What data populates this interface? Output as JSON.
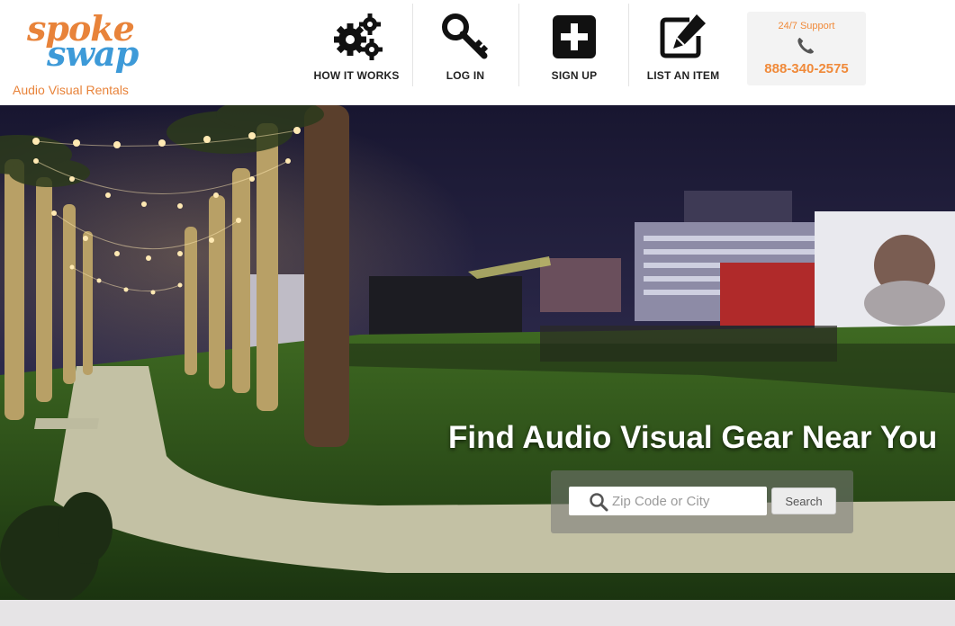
{
  "brand": {
    "logo_line1": "spoke",
    "logo_line2": "swap",
    "tagline": "Audio Visual Rentals",
    "colors": {
      "orange": "#e8833a",
      "blue": "#3d9ad8"
    }
  },
  "nav": [
    {
      "label": "HOW IT WORKS",
      "icon": "gears-icon"
    },
    {
      "label": "LOG IN",
      "icon": "key-icon"
    },
    {
      "label": "SIGN UP",
      "icon": "plus-square-icon"
    },
    {
      "label": "LIST AN ITEM",
      "icon": "edit-pencil-icon"
    }
  ],
  "support": {
    "label": "24/7 Support",
    "phone": "888-340-2575",
    "icon": "phone-icon"
  },
  "hero": {
    "headline": "Find Audio Visual Gear Near You",
    "search": {
      "placeholder": "Zip Code or City",
      "button_label": "Search",
      "icon": "search-icon"
    }
  }
}
